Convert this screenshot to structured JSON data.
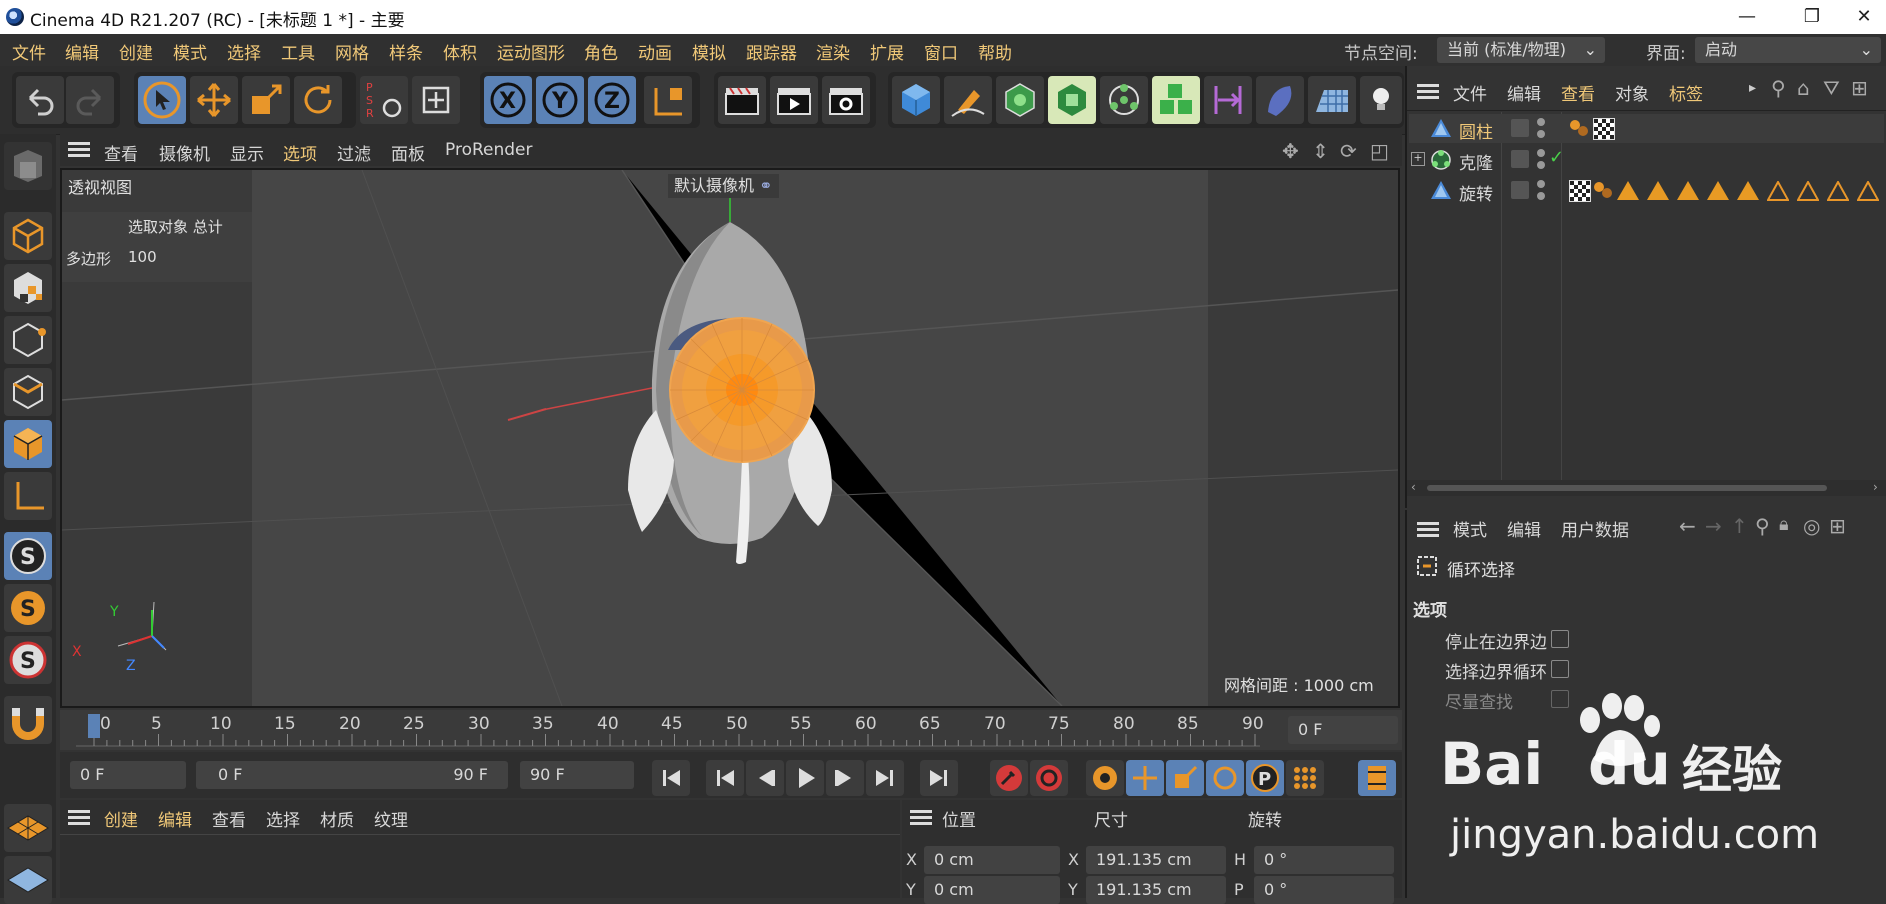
{
  "window": {
    "title": "Cinema 4D R21.207 (RC) - [未标题 1 *] - 主要",
    "minimize": "—",
    "restore": "❐",
    "close": "✕"
  },
  "menubar": {
    "items": [
      "文件",
      "编辑",
      "创建",
      "模式",
      "选择",
      "工具",
      "网格",
      "样条",
      "体积",
      "运动图形",
      "角色",
      "动画",
      "模拟",
      "跟踪器",
      "渲染",
      "扩展",
      "窗口",
      "帮助"
    ],
    "node_space_label": "节点空间:",
    "node_space_value": "当前 (标准/物理)",
    "layout_label": "界面:",
    "layout_value": "启动"
  },
  "viewport": {
    "menu": [
      "查看",
      "摄像机",
      "显示",
      "选项",
      "过滤",
      "面板",
      "ProRender"
    ],
    "view_name": "透视视图",
    "camera_label": "默认摄像机",
    "stats_header": "选取对象 总计",
    "stats_label": "多边形",
    "stats_value": "100",
    "grid_spacing": "网格间距 : 1000 cm",
    "axis_x": "X",
    "axis_y": "Y",
    "axis_z": "Z"
  },
  "timeline": {
    "ticks": [
      "0",
      "5",
      "10",
      "15",
      "20",
      "25",
      "30",
      "35",
      "40",
      "45",
      "50",
      "55",
      "60",
      "65",
      "70",
      "75",
      "80",
      "85",
      "90"
    ],
    "current_frame": "0 F"
  },
  "transport": {
    "start_field": "0 F",
    "range_start": "0 F",
    "range_end": "90 F",
    "end_field": "90 F"
  },
  "material_panel": {
    "menu": [
      "创建",
      "编辑",
      "查看",
      "选择",
      "材质",
      "纹理"
    ]
  },
  "coord_panel": {
    "headers": [
      "位置",
      "尺寸",
      "旋转"
    ],
    "row1": {
      "axis1": "X",
      "pos": "0 cm",
      "axis2": "X",
      "size": "191.135 cm",
      "axis3": "H",
      "rot": "0 °"
    },
    "row2": {
      "axis1": "Y",
      "pos": "0 cm",
      "axis2": "Y",
      "size": "191.135 cm",
      "axis3": "P",
      "rot": "0 °"
    }
  },
  "object_manager": {
    "menu": [
      "文件",
      "编辑",
      "查看",
      "对象",
      "标签"
    ],
    "objects": [
      {
        "name": "圆柱"
      },
      {
        "name": "克隆"
      },
      {
        "name": "旋转"
      }
    ]
  },
  "attribute_manager": {
    "menu": [
      "模式",
      "编辑",
      "用户数据"
    ],
    "tool_name": "循环选择",
    "section": "选项",
    "options": [
      "停止在边界边",
      "选择边界循环",
      "尽量查找"
    ]
  },
  "watermark": {
    "brand_a": "Bai",
    "brand_b": "du",
    "brand_c": "经验",
    "url": "jingyan.baidu.com"
  },
  "colors": {
    "accent_orange": "#f0c878",
    "icon_blue": "#5b82b6",
    "background": "#333333"
  }
}
